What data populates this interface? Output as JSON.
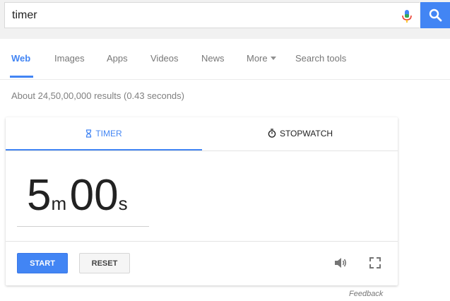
{
  "search": {
    "query": "timer"
  },
  "nav": {
    "items": [
      {
        "label": "Web"
      },
      {
        "label": "Images"
      },
      {
        "label": "Apps"
      },
      {
        "label": "Videos"
      },
      {
        "label": "News"
      },
      {
        "label": "More"
      },
      {
        "label": "Search tools"
      }
    ],
    "active": "Web"
  },
  "result_stats": "About 24,50,00,000 results (0.43 seconds)",
  "timer_card": {
    "tabs": [
      {
        "label": "TIMER",
        "icon": "hourglass-icon"
      },
      {
        "label": "STOPWATCH",
        "icon": "stopwatch-icon"
      }
    ],
    "active_tab": "TIMER",
    "minutes": "5",
    "minutes_unit": "m",
    "seconds": "00",
    "seconds_unit": "s",
    "start_label": "START",
    "reset_label": "RESET",
    "sound_icon": "speaker-icon",
    "fullscreen_icon": "fullscreen-icon"
  },
  "feedback": "Feedback",
  "colors": {
    "accent": "#4285f4",
    "header_bg": "#f1f1f1",
    "text": "#222222",
    "muted": "#777777"
  }
}
